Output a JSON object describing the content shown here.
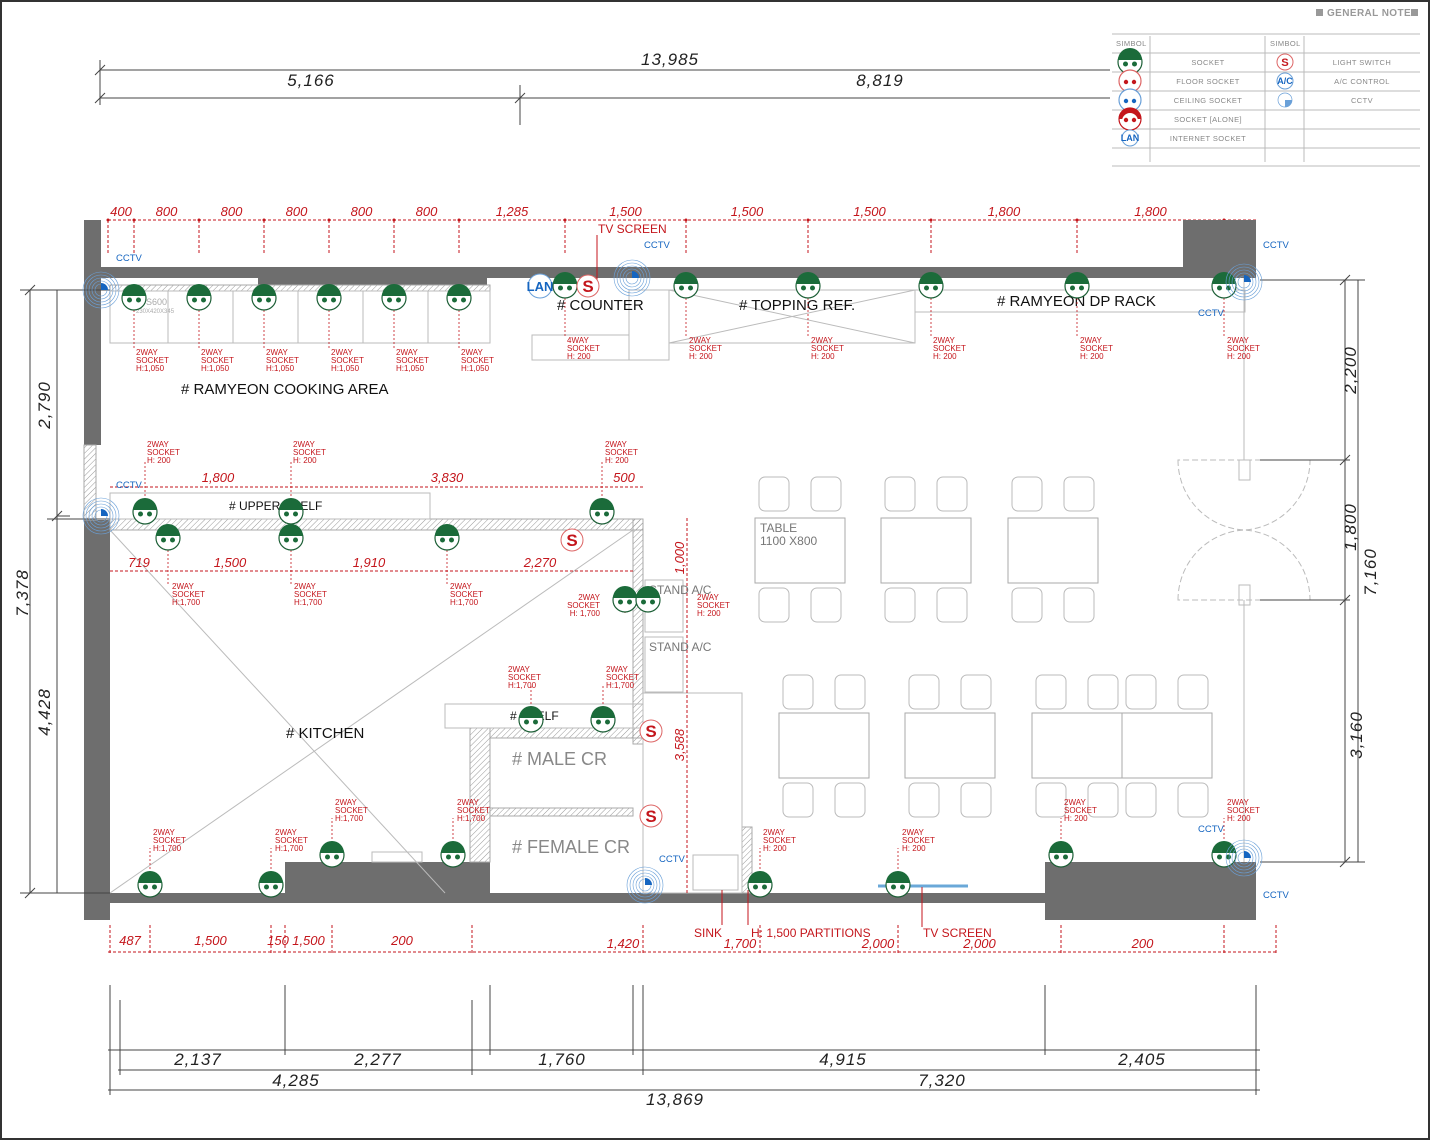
{
  "legend": {
    "title": "GENERAL NOTE",
    "header_left": "SIMBOL",
    "header_right": "SIMBOL",
    "left_items": [
      "SOCKET",
      "FLOOR SOCKET",
      "CEILING SOCKET",
      "SOCKET [ALONE]",
      "INTERNET SOCKET"
    ],
    "right_items": [
      "LIGHT SWITCH",
      "A/C CONTROL",
      "CCTV"
    ],
    "symbol_switch": "S",
    "symbol_ac": "A/C",
    "symbol_lan": "LAN"
  },
  "colors": {
    "wall": "#6e6e6e",
    "dimension": "#c4161c",
    "socket": "#1b6b3a",
    "cctv": "#1565c0"
  },
  "top_dims": {
    "overall": "13,985",
    "left": "5,166",
    "right": "8,819"
  },
  "top_row_dims": [
    "400",
    "800",
    "800",
    "800",
    "800",
    "800",
    "1,285",
    "1,500",
    "1,500",
    "1,500",
    "1,800",
    "1,800"
  ],
  "left_dims": {
    "upper": "2,790",
    "overall": "7,378",
    "lower": "4,428"
  },
  "right_dims": {
    "upper": "2,200",
    "middle": "1,800",
    "overall": "7,160",
    "lower": "3,160"
  },
  "mid_dims": {
    "a": "1,800",
    "b": "3,830",
    "c": "500",
    "d": "719",
    "e": "1,500",
    "f": "1,910",
    "g": "2,270",
    "h": "1,000",
    "i": "3,588"
  },
  "bottom_row_dims": [
    "487",
    "1,500",
    "150",
    "1,500",
    "200",
    "1,420",
    "1,700",
    "2,000",
    "2,000",
    "200"
  ],
  "bottom_dims": {
    "a": "2,137",
    "b": "2,277",
    "c": "1,760",
    "d": "4,915",
    "e": "2,405",
    "f": "4,285",
    "g": "7,320",
    "overall": "13,869"
  },
  "rooms": {
    "cooking": "# RAMYEON COOKING AREA",
    "counter": "# COUNTER",
    "topping": "# TOPPING REF.",
    "dp_rack": "# RAMYEON DP RACK",
    "upper_shelf": "# UPPER SHELF",
    "kitchen": "# KITCHEN",
    "shelf": "# SHELF",
    "male_cr": "# MALE CR",
    "female_cr": "# FEMALE CR"
  },
  "annotations": {
    "tv_screen_top": "TV SCREEN",
    "tv_screen_bottom": "TV SCREEN",
    "sink": "SINK",
    "partitions": "H: 1,500 PARTITIONS",
    "stand_ac_1": "STAND A/C",
    "stand_ac_2": "STAND A/C",
    "table_label": "TABLE",
    "table_size": "1100 X800",
    "stove_model": "S600",
    "stove_size": "230X420X345",
    "cctv": "CCTV",
    "lan": "LAN",
    "switch": "S"
  },
  "socket_notes": [
    [
      "2WAY",
      "SOCKET",
      "H:1,050"
    ],
    [
      "2WAY",
      "SOCKET",
      "H:1,050"
    ],
    [
      "2WAY",
      "SOCKET",
      "H:1,050"
    ],
    [
      "2WAY",
      "SOCKET",
      "H:1,050"
    ],
    [
      "2WAY",
      "SOCKET",
      "H:1,050"
    ],
    [
      "2WAY",
      "SOCKET",
      "H:1,050"
    ],
    [
      "4WAY",
      "SOCKET",
      "H: 200"
    ],
    [
      "2WAY",
      "SOCKET",
      "H: 200"
    ],
    [
      "2WAY",
      "SOCKET",
      "H: 200"
    ],
    [
      "2WAY",
      "SOCKET",
      "H: 200"
    ],
    [
      "2WAY",
      "SOCKET",
      "H: 200"
    ],
    [
      "2WAY",
      "SOCKET",
      "H: 200"
    ],
    [
      "2WAY",
      "SOCKET",
      "H: 200"
    ],
    [
      "2WAY",
      "SOCKET",
      "H: 200"
    ],
    [
      "2WAY",
      "SOCKET",
      "H: 200"
    ],
    [
      "2WAY",
      "SOCKET",
      "H:1,700"
    ],
    [
      "2WAY",
      "SOCKET",
      "H:1,700"
    ],
    [
      "2WAY",
      "SOCKET",
      "H:1,700"
    ],
    [
      "2WAY",
      "SOCKET",
      "H: 1,700"
    ],
    [
      "2WAY",
      "SOCKET",
      "H: 200"
    ],
    [
      "2WAY",
      "SOCKET",
      "H:1,700"
    ],
    [
      "2WAY",
      "SOCKET",
      "H:1,700"
    ],
    [
      "2WAY",
      "SOCKET",
      "H:1,700"
    ],
    [
      "2WAY",
      "SOCKET",
      "H:1,700"
    ],
    [
      "2WAY",
      "SOCKET",
      "H:1,700"
    ],
    [
      "2WAY",
      "SOCKET",
      "H:1,700"
    ],
    [
      "2WAY",
      "SOCKET",
      "H: 200"
    ],
    [
      "2WAY",
      "SOCKET",
      "H: 200"
    ],
    [
      "2WAY",
      "SOCKET",
      "H: 200"
    ],
    [
      "2WAY",
      "SOCKET",
      "H: 200"
    ]
  ]
}
